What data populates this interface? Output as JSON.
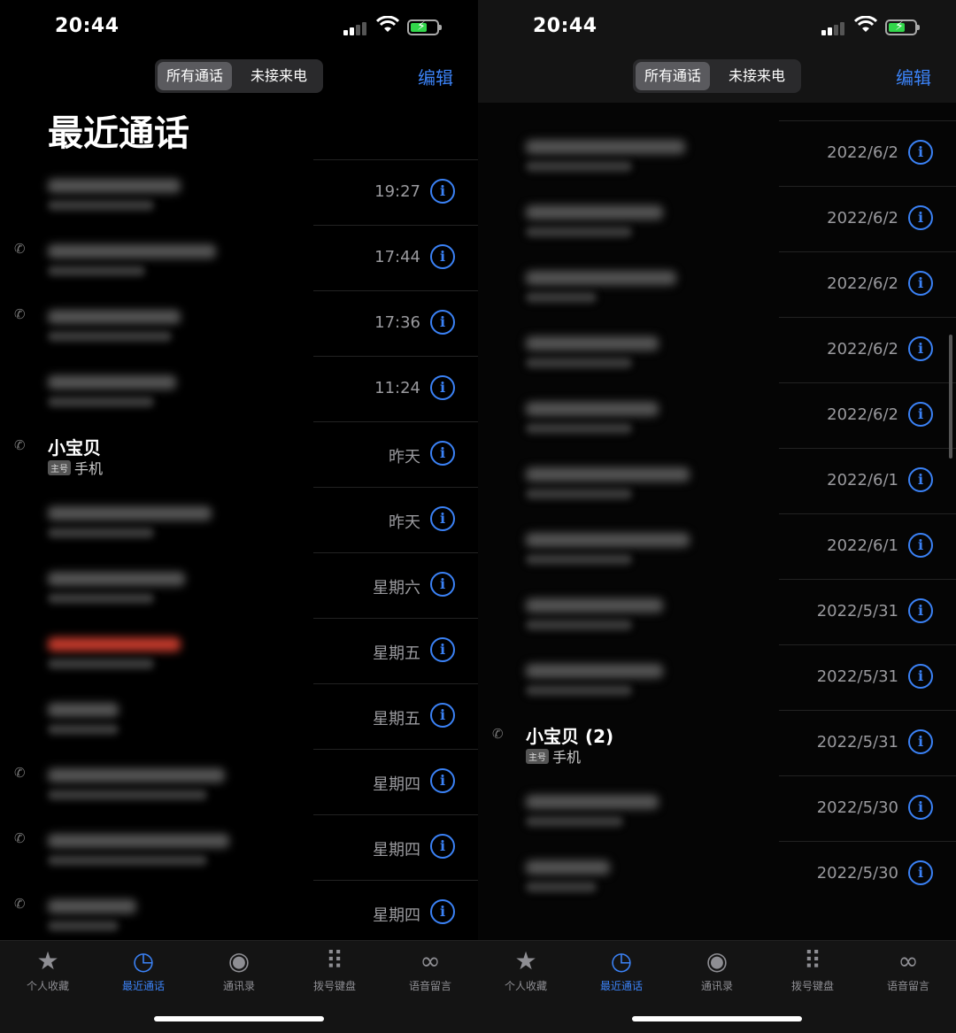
{
  "status": {
    "time": "20:44"
  },
  "segments": {
    "all": "所有通话",
    "missed": "未接来电"
  },
  "edit_label": "编辑",
  "title": "最近通话",
  "left_rows": [
    {
      "type": "blur",
      "time": "19:27",
      "callicon": false,
      "w1": 150,
      "w2": 120
    },
    {
      "type": "blur",
      "time": "17:44",
      "callicon": true,
      "w1": 190,
      "w2": 110
    },
    {
      "type": "blur",
      "time": "17:36",
      "callicon": true,
      "w1": 150,
      "w2": 140
    },
    {
      "type": "blur",
      "time": "11:24",
      "callicon": false,
      "w1": 145,
      "w2": 120
    },
    {
      "type": "named",
      "name": "小宝贝",
      "tag": "主号",
      "sub": "手机",
      "time": "昨天",
      "callicon": true
    },
    {
      "type": "blur",
      "time": "昨天",
      "callicon": false,
      "w1": 185,
      "w2": 120
    },
    {
      "type": "blur",
      "time": "星期六",
      "callicon": false,
      "w1": 155,
      "w2": 120
    },
    {
      "type": "blur",
      "time": "星期五",
      "callicon": false,
      "w1": 150,
      "w2": 120,
      "red": true
    },
    {
      "type": "blur",
      "time": "星期五",
      "callicon": false,
      "w1": 80,
      "w2": 80
    },
    {
      "type": "blur",
      "time": "星期四",
      "callicon": true,
      "w1": 200,
      "w2": 180
    },
    {
      "type": "blur",
      "time": "星期四",
      "callicon": true,
      "w1": 205,
      "w2": 180
    },
    {
      "type": "blur",
      "time": "星期四",
      "callicon": true,
      "w1": 100,
      "w2": 80
    }
  ],
  "right_rows": [
    {
      "type": "blur",
      "time": "2022/6/2",
      "callicon": false,
      "w1": 180,
      "w2": 120
    },
    {
      "type": "blur",
      "time": "2022/6/2",
      "callicon": false,
      "w1": 155,
      "w2": 120
    },
    {
      "type": "blur",
      "time": "2022/6/2",
      "callicon": false,
      "w1": 170,
      "w2": 80
    },
    {
      "type": "blur",
      "time": "2022/6/2",
      "callicon": false,
      "w1": 150,
      "w2": 120
    },
    {
      "type": "blur",
      "time": "2022/6/2",
      "callicon": false,
      "w1": 150,
      "w2": 120
    },
    {
      "type": "blur",
      "time": "2022/6/1",
      "callicon": false,
      "w1": 185,
      "w2": 120
    },
    {
      "type": "blur",
      "time": "2022/6/1",
      "callicon": false,
      "w1": 185,
      "w2": 120
    },
    {
      "type": "blur",
      "time": "2022/5/31",
      "callicon": false,
      "w1": 155,
      "w2": 120
    },
    {
      "type": "blur",
      "time": "2022/5/31",
      "callicon": false,
      "w1": 155,
      "w2": 120
    },
    {
      "type": "named",
      "name": "小宝贝 (2)",
      "tag": "主号",
      "sub": "手机",
      "time": "2022/5/31",
      "callicon": true
    },
    {
      "type": "blur",
      "time": "2022/5/30",
      "callicon": false,
      "w1": 150,
      "w2": 110
    },
    {
      "type": "blur",
      "time": "2022/5/30",
      "callicon": false,
      "w1": 95,
      "w2": 80
    }
  ],
  "tabs": [
    {
      "label": "个人收藏",
      "icon": "star-icon",
      "active": false
    },
    {
      "label": "最近通话",
      "icon": "clock-icon",
      "active": true
    },
    {
      "label": "通讯录",
      "icon": "person-icon",
      "active": false
    },
    {
      "label": "拨号键盘",
      "icon": "keypad-icon",
      "active": false
    },
    {
      "label": "语音留言",
      "icon": "voicemail-icon",
      "active": false
    }
  ]
}
